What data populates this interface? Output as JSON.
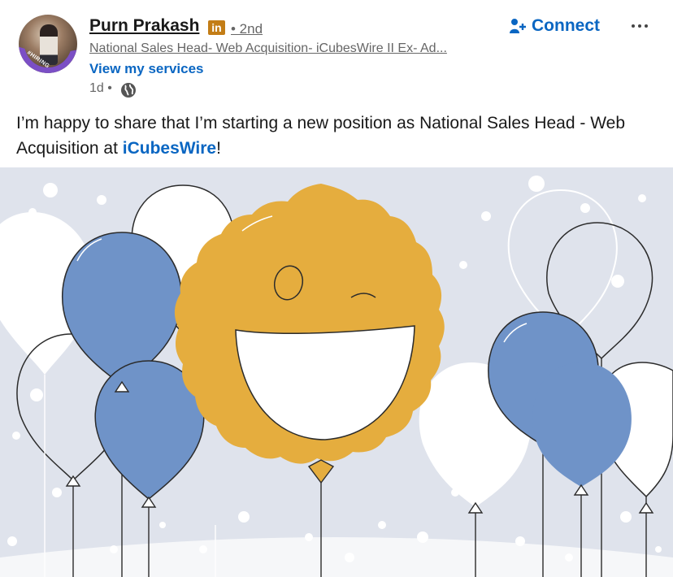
{
  "author": {
    "name": "Purn Prakash",
    "badge": "in",
    "degree": "• 2nd",
    "headline": "National Sales Head- Web Acquisition- iCubesWire II Ex- Ad...",
    "services_link": "View my services",
    "time": "1d •",
    "avatar_frame_text": "#HIRING"
  },
  "actions": {
    "connect_label": "Connect"
  },
  "post": {
    "text_before": "I’m happy to share that I’m starting a new position as National Sales Head - Web Acquisition at ",
    "mention": "iCubesWire",
    "text_after": "!"
  },
  "colors": {
    "accent": "#0a66c2",
    "balloon_blue": "#6f93c8",
    "smiley_yellow": "#e5ad3e",
    "image_bg": "#dfe3ec"
  },
  "icons": [
    "add-person-icon",
    "more-options-icon",
    "globe-icon",
    "linkedin-badge-icon"
  ]
}
